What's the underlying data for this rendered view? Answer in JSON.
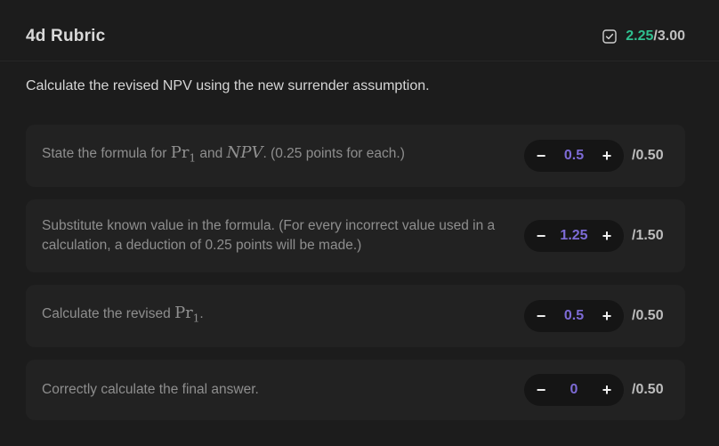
{
  "header": {
    "title": "4d Rubric",
    "score_earned": "2.25",
    "score_separator": "/",
    "score_total": "3.00",
    "score_icon": "checkbox-check-icon",
    "earned_color": "#2fbf8f"
  },
  "question": "Calculate the revised NPV using the new surrender assumption.",
  "criteria": [
    {
      "text_before": "State the formula for ",
      "math1": "Pr",
      "math1_sub": "1",
      "text_mid": " and ",
      "math2": "NPV",
      "text_after": ". (0.25 points for each.)",
      "value": "0.5",
      "max": "/0.50"
    },
    {
      "text": "Substitute known value in the formula. (For every incorrect value used in a calculation, a deduction of 0.25 points will be made.)",
      "value": "1.25",
      "max": "/1.50"
    },
    {
      "text_before": "Calculate the revised ",
      "math1": "Pr",
      "math1_sub": "1",
      "text_after": ".",
      "value": "0.5",
      "max": "/0.50"
    },
    {
      "text": "Correctly calculate the final answer.",
      "value": "0",
      "max": "/0.50"
    }
  ],
  "stepper": {
    "minus_label": "−",
    "plus_label": "+",
    "value_color": "#7d6bd6"
  }
}
